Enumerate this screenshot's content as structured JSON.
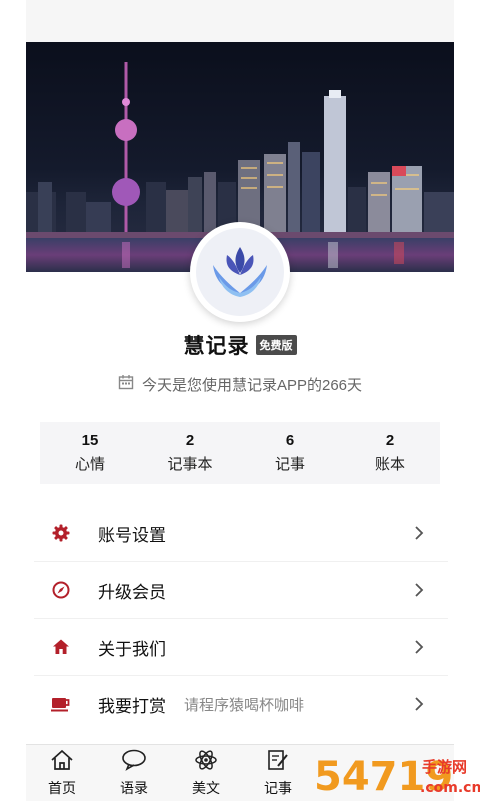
{
  "profile": {
    "app_name": "慧记录",
    "badge": "免费版",
    "days_text": "今天是您使用慧记录APP的266天",
    "avatar_icon": "lotus-hands-icon"
  },
  "stats": [
    {
      "value": "15",
      "label": "心情"
    },
    {
      "value": "2",
      "label": "记事本"
    },
    {
      "value": "6",
      "label": "记事"
    },
    {
      "value": "2",
      "label": "账本"
    }
  ],
  "menu": [
    {
      "icon": "gear-icon",
      "label": "账号设置",
      "subtitle": ""
    },
    {
      "icon": "compass-icon",
      "label": "升级会员",
      "subtitle": ""
    },
    {
      "icon": "home-icon",
      "label": "关于我们",
      "subtitle": ""
    },
    {
      "icon": "coffee-cup-icon",
      "label": "我要打赏",
      "subtitle": "请程序猿喝杯咖啡"
    }
  ],
  "tabbar": [
    {
      "icon": "home-outline-icon",
      "label": "首页"
    },
    {
      "icon": "chat-bubble-icon",
      "label": "语录"
    },
    {
      "icon": "atom-icon",
      "label": "美文"
    },
    {
      "icon": "note-edit-icon",
      "label": "记事"
    }
  ],
  "watermark": {
    "logo": "54719",
    "line1": "手游网",
    "line2": ".com.cn"
  },
  "colors": {
    "accent": "#b3202a",
    "badge_bg": "#4b4b4b",
    "stats_bg": "#f5f5f7"
  }
}
